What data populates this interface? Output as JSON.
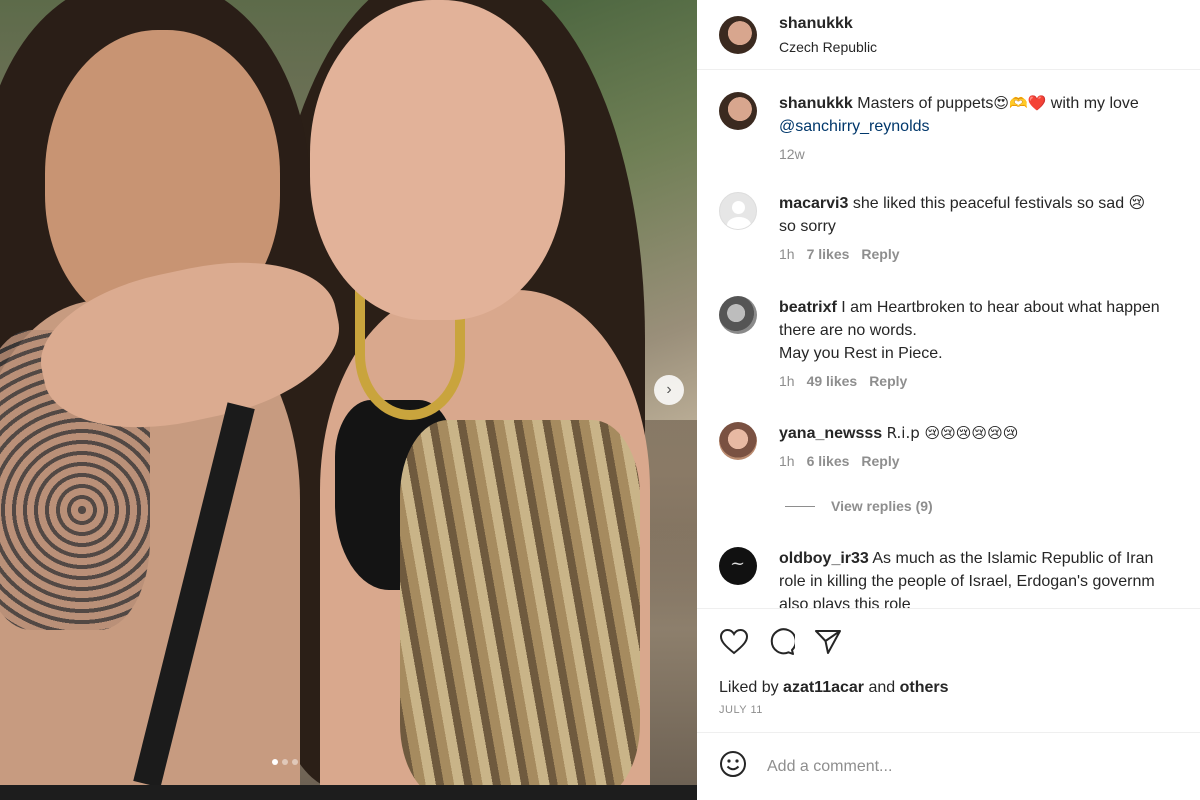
{
  "post": {
    "author": "shanukkk",
    "location": "Czech Republic",
    "caption": {
      "user": "shanukkk",
      "text": "Masters of puppets",
      "emojis": "😍🫶❤️",
      "after": "with my love",
      "mention": "@sanchirry_reynolds",
      "time": "12w"
    },
    "liked_by_prefix": "Liked by",
    "liked_by_user": "azat11acar",
    "liked_by_and": "and",
    "liked_by_others": "others",
    "date": "JULY 11"
  },
  "comments": [
    {
      "user": "macarvi3",
      "lines": [
        "she liked this peaceful festivals so sad 😢",
        "so sorry"
      ],
      "time": "1h",
      "likes": "7 likes",
      "reply": "Reply"
    },
    {
      "user": "beatrixf",
      "lines": [
        "I am Heartbroken to hear about what happen",
        "there are no words.",
        "May you Rest in Piece."
      ],
      "time": "1h",
      "likes": "49 likes",
      "reply": "Reply"
    },
    {
      "user": "yana_newsss",
      "lines": [
        "R.i.p 😢😢😢😢😢😢"
      ],
      "time": "1h",
      "likes": "6 likes",
      "reply": "Reply"
    },
    {
      "user": "oldboy_ir33",
      "lines": [
        "As much as the Islamic Republic of Iran",
        "role in killing the people of Israel, Erdogan's governm",
        "also plays this role"
      ]
    }
  ],
  "view_replies": "View replies (9)",
  "comment_box": {
    "placeholder": "Add a comment..."
  },
  "icons": {
    "like": "heart-icon",
    "comment": "comment-icon",
    "share": "share-icon",
    "emoji": "emoji-icon",
    "carousel_next": "chevron-right-icon"
  },
  "colors": {
    "mention": "#00376b",
    "secondary_text": "#8e8e8e"
  }
}
